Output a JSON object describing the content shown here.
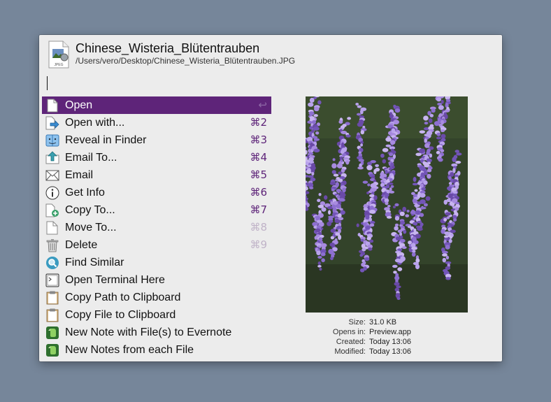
{
  "file": {
    "title": "Chinese_Wisteria_Blütentrauben",
    "path": "/Users/vero/Desktop/Chinese_Wisteria_Blütentrauben.JPG",
    "icon_label": "JPEG"
  },
  "actions": [
    {
      "label": "Open",
      "shortcut": "↩",
      "icon": "document-icon",
      "selected": true
    },
    {
      "label": "Open with...",
      "shortcut": "⌘2",
      "icon": "open-with-icon"
    },
    {
      "label": "Reveal in Finder",
      "shortcut": "⌘3",
      "icon": "finder-icon"
    },
    {
      "label": "Email To...",
      "shortcut": "⌘4",
      "icon": "email-to-icon"
    },
    {
      "label": "Email",
      "shortcut": "⌘5",
      "icon": "envelope-icon"
    },
    {
      "label": "Get Info",
      "shortcut": "⌘6",
      "icon": "info-icon"
    },
    {
      "label": "Copy To...",
      "shortcut": "⌘7",
      "icon": "copy-to-icon"
    },
    {
      "label": "Move To...",
      "shortcut": "⌘8",
      "icon": "move-to-icon"
    },
    {
      "label": "Delete",
      "shortcut": "⌘9",
      "icon": "trash-icon"
    },
    {
      "label": "Find Similar",
      "shortcut": "",
      "icon": "magnifier-icon"
    },
    {
      "label": "Open Terminal Here",
      "shortcut": "",
      "icon": "terminal-icon"
    },
    {
      "label": "Copy Path to Clipboard",
      "shortcut": "",
      "icon": "clipboard-icon"
    },
    {
      "label": "Copy File to Clipboard",
      "shortcut": "",
      "icon": "clipboard-icon"
    },
    {
      "label": "New Note with File(s) to Evernote",
      "shortcut": "",
      "icon": "evernote-icon"
    },
    {
      "label": "New Notes from each File",
      "shortcut": "",
      "icon": "evernote-icon"
    }
  ],
  "metadata": {
    "size_label": "Size:",
    "size": "31.0 KB",
    "opens_label": "Opens in:",
    "opens": "Preview.app",
    "created_label": "Created:",
    "created": "Today 13:06",
    "modified_label": "Modified:",
    "modified": "Today 13:06"
  },
  "colors": {
    "selection": "#5e2479",
    "shortcut": "#5e2479",
    "background": "#76869a"
  }
}
